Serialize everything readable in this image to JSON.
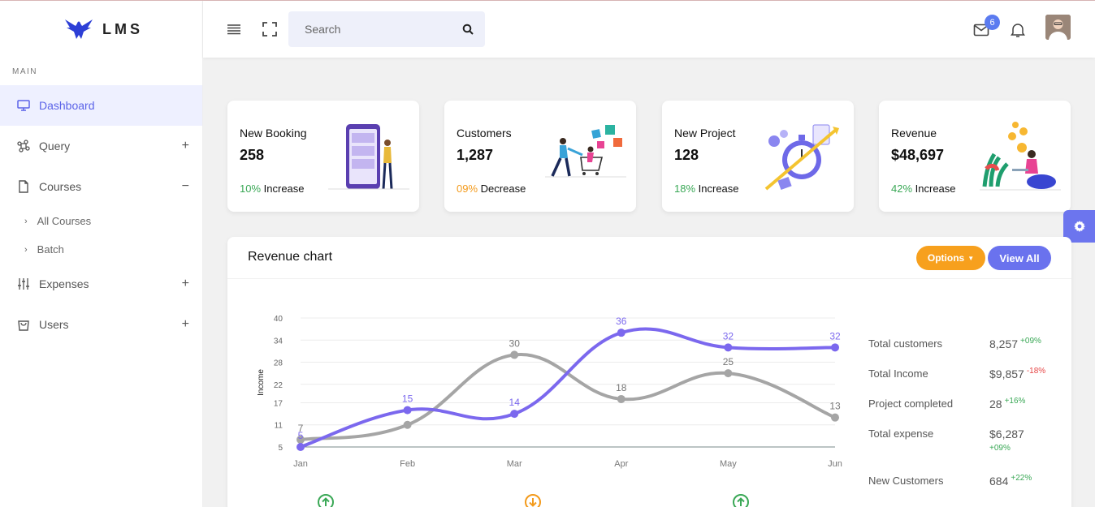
{
  "brand": {
    "name": "LMS"
  },
  "sidebar": {
    "section": "MAIN",
    "items": [
      {
        "label": "Dashboard",
        "icon": "monitor-icon",
        "sign": ""
      },
      {
        "label": "Query",
        "icon": "command-icon",
        "sign": "+"
      },
      {
        "label": "Courses",
        "icon": "file-icon",
        "sign": "−"
      },
      {
        "label": "Expenses",
        "icon": "sliders-icon",
        "sign": "+"
      },
      {
        "label": "Users",
        "icon": "shopping-bag-icon",
        "sign": "+"
      }
    ],
    "subitems": [
      {
        "label": "All Courses"
      },
      {
        "label": "Batch"
      }
    ]
  },
  "header": {
    "search_placeholder": "Search",
    "mail_count": "6"
  },
  "cards": [
    {
      "title": "New Booking",
      "value": "258",
      "delta": "10%",
      "delta_text": "Increase",
      "tone": "green"
    },
    {
      "title": "Customers",
      "value": "1,287",
      "delta": "09%",
      "delta_text": "Decrease",
      "tone": "orange"
    },
    {
      "title": "New Project",
      "value": "128",
      "delta": "18%",
      "delta_text": "Increase",
      "tone": "green"
    },
    {
      "title": "Revenue",
      "value": "$48,697",
      "delta": "42%",
      "delta_text": "Increase",
      "tone": "green"
    }
  ],
  "panel": {
    "title": "Revenue chart",
    "options_label": "Options",
    "view_all_label": "View All"
  },
  "chart_data": {
    "type": "line",
    "categories": [
      "Jan",
      "Feb",
      "Mar",
      "Apr",
      "May",
      "Jun"
    ],
    "ylabel": "Income",
    "yticks": [
      5,
      11,
      17,
      22,
      28,
      34,
      40
    ],
    "ylim": [
      5,
      40
    ],
    "grid": true,
    "series": [
      {
        "color": "#7b68ee",
        "values": [
          5,
          15,
          14,
          36,
          32,
          32
        ],
        "labels": [
          "5",
          "15",
          "14",
          "36",
          "32",
          "32"
        ]
      },
      {
        "color": "#a5a5a5",
        "values": [
          7,
          11,
          30,
          18,
          25,
          13
        ],
        "labels": [
          "7",
          "",
          "30",
          "18",
          "25",
          "13"
        ]
      }
    ]
  },
  "stats": [
    {
      "label": "Total customers",
      "value": "8,257",
      "delta": "+09%",
      "tone": "pos"
    },
    {
      "label": "Total Income",
      "value": "$9,857",
      "delta": "-18%",
      "tone": "neg"
    },
    {
      "label": "Project completed",
      "value": "28",
      "delta": "+16%",
      "tone": "pos"
    },
    {
      "label": "Total expense",
      "value": "$6,287",
      "delta": "+09%",
      "tone": "pos"
    },
    {
      "label": "New Customers",
      "value": "684",
      "delta": "+22%",
      "tone": "pos"
    }
  ],
  "colors": {
    "accent": "#5b63e8",
    "series_primary": "#7b68ee",
    "series_secondary": "#a5a5a5",
    "options_button": "#f7a01d",
    "view_button": "#6a72ee",
    "positive": "#3aa856",
    "negative": "#e64545"
  }
}
